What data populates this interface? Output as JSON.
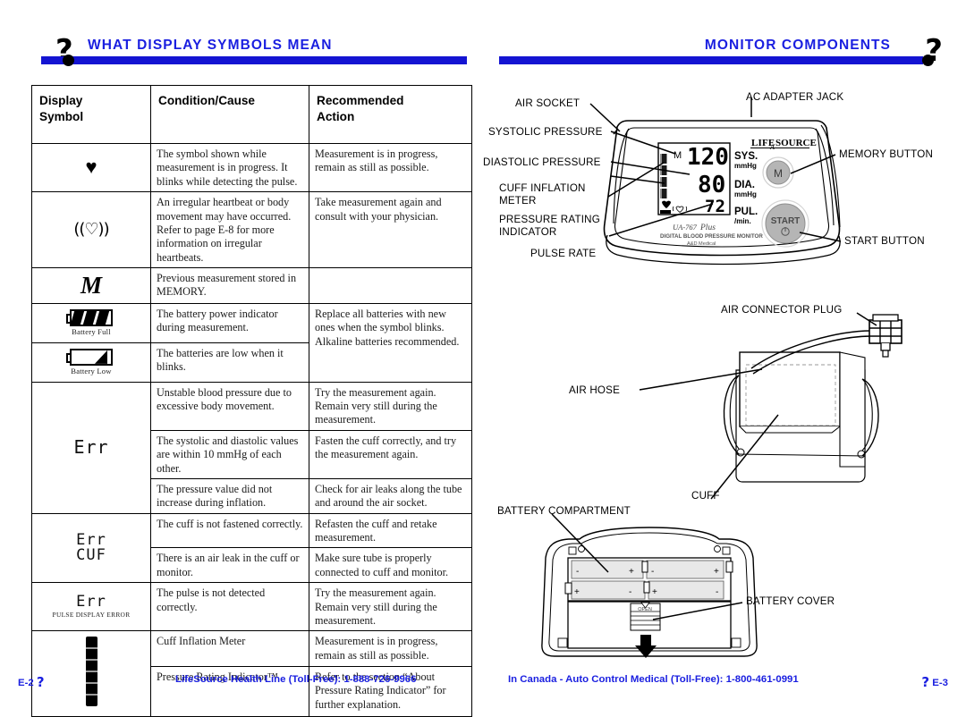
{
  "left_page": {
    "header": {
      "title": "WHAT DISPLAY SYMBOLS MEAN",
      "icon": "question-mark-icon"
    },
    "table": {
      "headers": [
        "Display Symbol",
        "Condition/Cause",
        "Recommended Action"
      ],
      "header_lines": [
        [
          "Display",
          "Symbol"
        ],
        [
          "Condition/Cause",
          ""
        ],
        [
          "Recommended",
          "Action"
        ]
      ],
      "rows": [
        {
          "symbol": {
            "type": "heart-solid",
            "glyph": "♥",
            "caption": ""
          },
          "condition": "The symbol shown while measurement is in progress. It blinks while detecting the pulse.",
          "action": "Measurement is in progress, remain as still as possible."
        },
        {
          "symbol": {
            "type": "heart-irregular",
            "glyph": "((♡))",
            "caption": ""
          },
          "condition": "An irregular heartbeat or body movement may have occurred. Refer to page E-8 for more information on irregular heartbeats.",
          "action": "Take measurement again and consult with your physician."
        },
        {
          "symbol": {
            "type": "memory-m",
            "glyph": "M",
            "caption": ""
          },
          "condition": "Previous measurement stored in MEMORY.",
          "action": ""
        },
        {
          "symbol": {
            "type": "battery-full",
            "glyph": "",
            "caption": "Battery Full"
          },
          "condition": "The battery power indicator during measurement.",
          "action": "Replace all batteries with new ones when the symbol blinks. Alkaline batteries recommended."
        },
        {
          "symbol": {
            "type": "battery-low",
            "glyph": "",
            "caption": "Battery Low"
          },
          "condition": "The batteries are low when it blinks.",
          "action": ""
        },
        {
          "symbol": {
            "type": "err",
            "glyph": "Err",
            "caption": ""
          },
          "condition": "Unstable blood pressure due to excessive body movement.",
          "action": "Try the measurement again. Remain very still during the measurement."
        },
        {
          "symbol": {
            "type": "err",
            "glyph": "Err",
            "caption": ""
          },
          "condition": "The systolic and diastolic values are within 10 mmHg of each other.",
          "action": "Fasten the cuff correctly, and try the measurement again."
        },
        {
          "symbol": {
            "type": "err",
            "glyph": "Err",
            "caption": ""
          },
          "condition": "The pressure value did not increase during inflation.",
          "action": "Check for air leaks along the tube and around the air socket."
        },
        {
          "symbol": {
            "type": "err-cuf",
            "glyph": "Err",
            "glyph2": "CUF",
            "caption": ""
          },
          "condition": "The cuff is not fastened correctly.",
          "action": "Refasten the cuff and retake measurement."
        },
        {
          "symbol": {
            "type": "err-cuf",
            "glyph": "Err",
            "glyph2": "CUF",
            "caption": ""
          },
          "condition": "There is an air leak in the cuff or monitor.",
          "action": "Make sure tube is properly connected to cuff and monitor."
        },
        {
          "symbol": {
            "type": "err-pulse",
            "glyph": "Err",
            "caption": "PULSE DISPLAY ERROR"
          },
          "condition": "The pulse is not detected correctly.",
          "action": "Try the measurement again. Remain very still during the measurement."
        },
        {
          "symbol": {
            "type": "meter-bar",
            "glyph": "",
            "caption": ""
          },
          "condition": "Cuff Inflation Meter",
          "action": "Measurement is in progress, remain as still as possible."
        },
        {
          "symbol": {
            "type": "meter-bar",
            "glyph": "",
            "caption": ""
          },
          "condition": "Pressure Rating Indicator™",
          "action": "Refer to the section “About Pressure Rating Indicator” for further explanation."
        }
      ]
    },
    "footer": {
      "page": "E-2",
      "text": "LifeSource Health Line (Toll-Free): 1-888-726-9966"
    }
  },
  "right_page": {
    "header": {
      "title": "MONITOR COMPONENTS",
      "icon": "question-mark-icon"
    },
    "monitor": {
      "labels": {
        "ac_adapter_jack": "AC ADAPTER JACK",
        "air_socket": "AIR SOCKET",
        "systolic_pressure": "SYSTOLIC PRESSURE",
        "diastolic_pressure": "DIASTOLIC PRESSURE",
        "cuff_inflation_meter_l1": "CUFF INFLATION",
        "cuff_inflation_meter_l2": "METER",
        "pressure_rating_indicator_l1": "PRESSURE RATING",
        "pressure_rating_indicator_l2": "INDICATOR",
        "pulse_rate": "PULSE RATE",
        "memory_button": "MEMORY BUTTON",
        "start_button": "START BUTTON"
      },
      "display": {
        "memory_marker": "M",
        "systolic": "120",
        "systolic_unit_main": "SYS.",
        "systolic_unit_sub": "mmHg",
        "diastolic": "80",
        "diastolic_unit_main": "DIA.",
        "diastolic_unit_sub": "mmHg",
        "pulse": "72",
        "pulse_unit_main": "PUL.",
        "pulse_unit_sub": "/min."
      },
      "brand": "LIFE SOURCE",
      "model": "UA-767 Plus",
      "model_sub": "DIGITAL BLOOD PRESSURE MONITOR",
      "maker": "A&D Medical",
      "memory_button_label": "M",
      "start_button_label": "START"
    },
    "cuff": {
      "labels": {
        "air_connector_plug": "AIR CONNECTOR PLUG",
        "air_hose": "AIR HOSE",
        "cuff": "CUFF"
      }
    },
    "battery": {
      "labels": {
        "battery_compartment": "BATTERY COMPARTMENT",
        "battery_cover": "BATTERY COVER"
      },
      "open_text": "OPEN",
      "polarity": [
        "-",
        "+",
        "-",
        "+",
        "+",
        "-",
        "+",
        "-"
      ]
    },
    "footer": {
      "page": "E-3",
      "text": "In Canada - Auto Control Medical (Toll-Free): 1-800-461-0991"
    }
  },
  "colors": {
    "accent_blue": "#1a1fe0",
    "bar_blue": "#1414d2",
    "ink": "#000000",
    "gray_button": "#b5b5b5"
  }
}
